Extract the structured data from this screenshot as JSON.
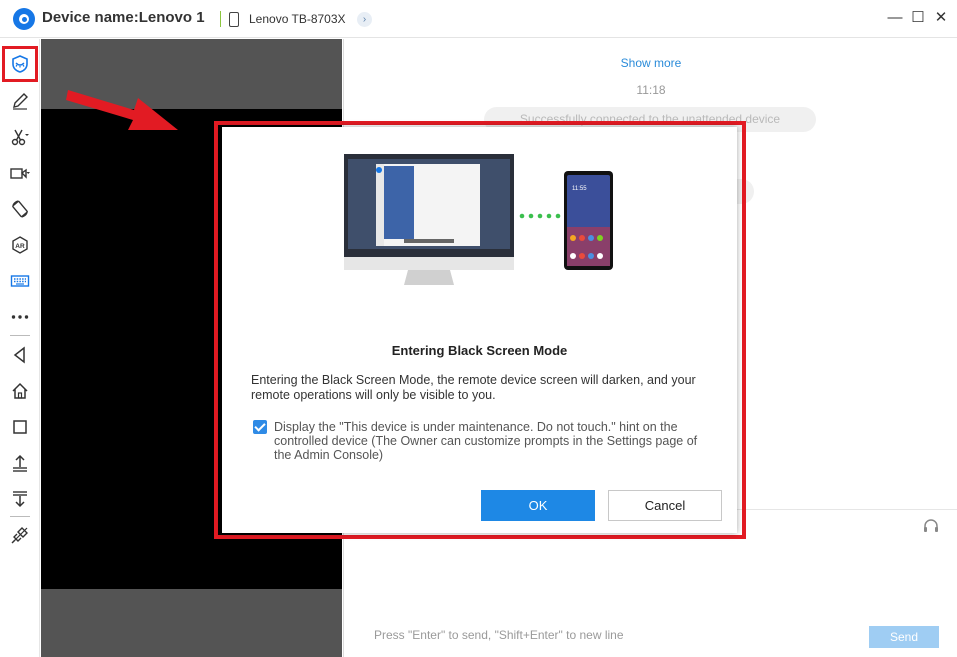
{
  "titlebar": {
    "title": "Device name:Lenovo 1",
    "device_model": "Lenovo TB-8703X",
    "minimize": "—",
    "maximize": "☐",
    "close": "✕"
  },
  "toolbar": {
    "items": [
      "black-screen-mode",
      "draw",
      "screenshot",
      "record",
      "rotate",
      "ar",
      "keyboard",
      "more",
      "back",
      "home",
      "recents",
      "upload",
      "download",
      "disconnect"
    ]
  },
  "chat": {
    "show_more": "Show more",
    "time": "11:18",
    "system_message": "Successfully connected to the unattended device",
    "input_hint": "Press \"Enter\" to send, \"Shift+Enter\" to new line",
    "send_label": "Send"
  },
  "dialog": {
    "title": "Entering Black Screen Mode",
    "description": "Entering the Black Screen Mode, the remote device screen will darken, and your remote operations will only be visible to you.",
    "checkbox_checked": true,
    "checkbox_label": "Display the \"This device is under maintenance. Do not touch.\" hint on the controlled device (The Owner can customize prompts in the Settings page of the Admin Console)",
    "ok_label": "OK",
    "cancel_label": "Cancel",
    "illustration_time": "11:55"
  },
  "colors": {
    "accent": "#1e88e5",
    "highlight": "#e21b23",
    "send_disabled": "#9fcdf3"
  }
}
